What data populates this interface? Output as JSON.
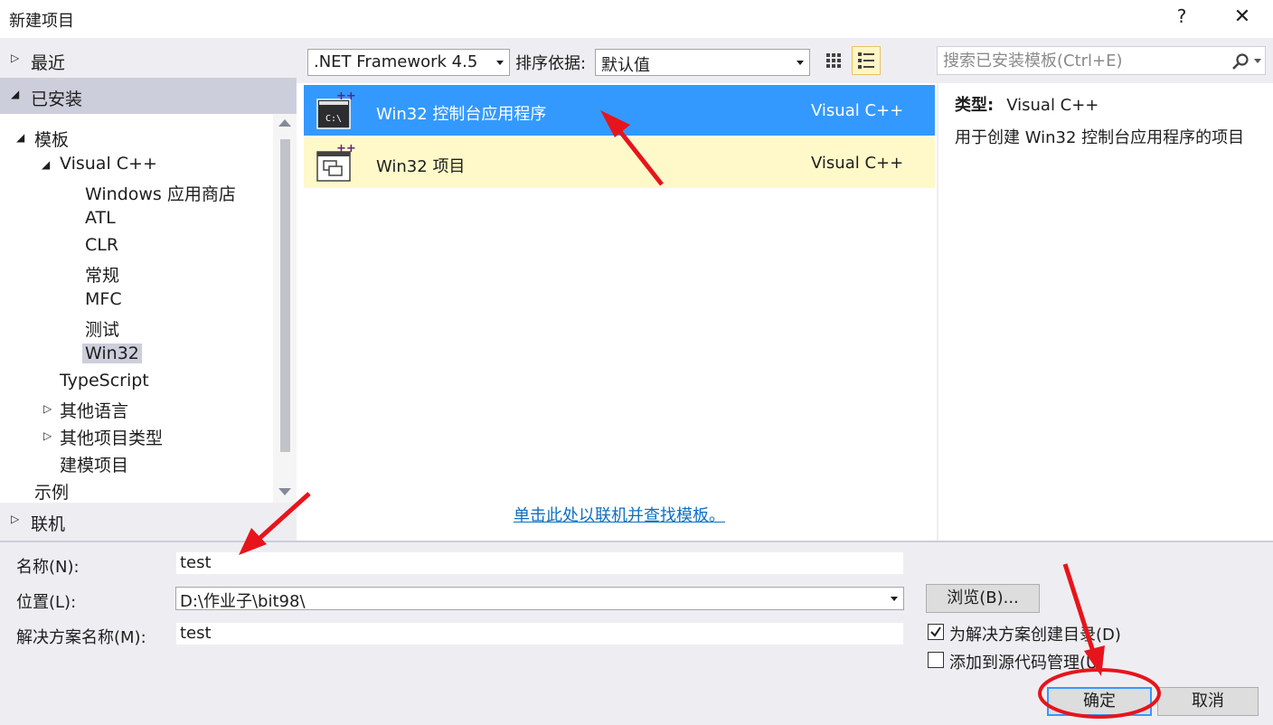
{
  "window": {
    "title": "新建项目",
    "help_label": "?",
    "close_label": "✕"
  },
  "left": {
    "recent": "最近",
    "installed": "已安装",
    "online": "联机",
    "tree": {
      "templates": "模板",
      "visual_cpp": "Visual C++",
      "children": [
        "Windows 应用商店",
        "ATL",
        "CLR",
        "常规",
        "MFC",
        "测试",
        "Win32"
      ],
      "typescript": "TypeScript",
      "other_languages": "其他语言",
      "other_project_types": "其他项目类型",
      "modeling_projects": "建模项目",
      "samples": "示例"
    }
  },
  "toolbar": {
    "framework": ".NET Framework 4.5",
    "sort_label": "排序依据:",
    "sort_value": "默认值",
    "search_placeholder": "搜索已安装模板(Ctrl+E)"
  },
  "templates": [
    {
      "name": "Win32 控制台应用程序",
      "lang": "Visual C++"
    },
    {
      "name": "Win32 项目",
      "lang": "Visual C++"
    }
  ],
  "online_link": "单击此处以联机并查找模板。",
  "description": {
    "type_label": "类型:",
    "type_value": "Visual C++",
    "text": "用于创建 Win32 控制台应用程序的项目"
  },
  "form": {
    "name_label": "名称(N):",
    "name_value": "test",
    "location_label": "位置(L):",
    "location_value": "D:\\作业子\\bit98\\",
    "solution_label": "解决方案名称(M):",
    "solution_value": "test",
    "browse_label": "浏览(B)...",
    "create_dir_label": "为解决方案创建目录(D)",
    "create_dir_checked": true,
    "source_control_label": "添加到源代码管理(U)",
    "source_control_checked": false,
    "ok_label": "确定",
    "cancel_label": "取消"
  },
  "colors": {
    "selection": "#3399ff",
    "hover_row": "#fff9c9",
    "panel_bg": "#eeeef2",
    "link": "#0e70c0",
    "annotation": "#e8141b"
  }
}
